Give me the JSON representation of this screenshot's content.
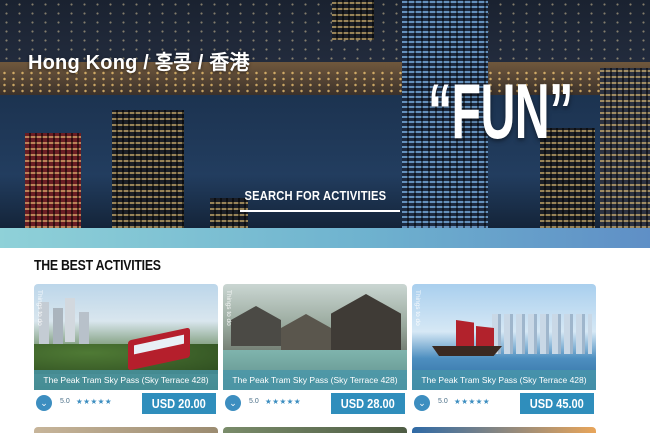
{
  "hero": {
    "title": "Hong Kong / 홍콩 / 香港",
    "headline": "“FUN”",
    "search_label": "SEARCH FOR ACTIVITIES"
  },
  "section": {
    "title": "THE BEST ACTIVITIES"
  },
  "cards": [
    {
      "vertical_label": "Things to do",
      "title": "The Peak Tram Sky Pass (Sky Terrace 428)",
      "rating": "5.0",
      "stars": "★★★★★",
      "price": "USD 20.00"
    },
    {
      "vertical_label": "Things to do",
      "title": "The Peak Tram Sky Pass (Sky Terrace 428)",
      "rating": "5.0",
      "stars": "★★★★★",
      "price": "USD 28.00"
    },
    {
      "vertical_label": "Things to do",
      "title": "The Peak Tram Sky Pass (Sky Terrace 428)",
      "rating": "5.0",
      "stars": "★★★★★",
      "price": "USD 45.00"
    }
  ],
  "icons": {
    "expand": "chevron-down-icon"
  },
  "colors": {
    "accent": "#2f8ebc",
    "band_start": "#8fd1d8",
    "band_end": "#5f8fc6"
  }
}
